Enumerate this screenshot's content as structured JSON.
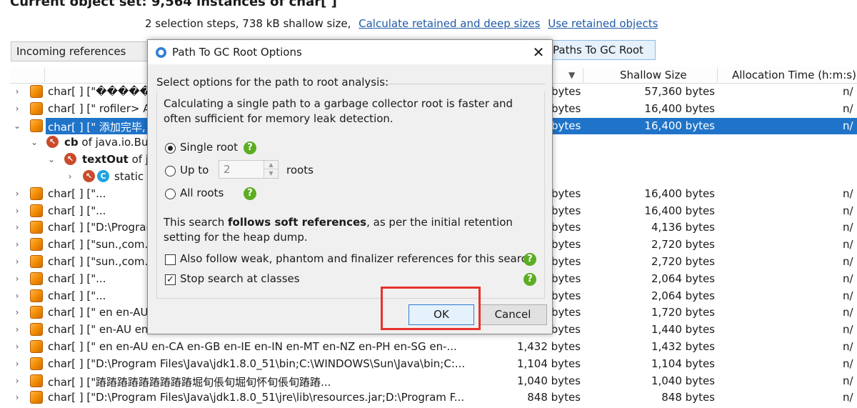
{
  "header": {
    "title": "Current object set:  9,564 instances of char[ ]",
    "summary": "2 selection steps, 738 kB shallow size,",
    "link_calc": "Calculate retained and deep sizes",
    "link_use": "Use retained objects"
  },
  "toolbar": {
    "incoming": "Incoming references",
    "paths": "Paths To GC Root"
  },
  "columns": {
    "sort_arrow": "▼",
    "shallow": "Shallow Size",
    "alloc": "Allocation Time (h:m:s)"
  },
  "rows": [
    {
      "text": "char[ ] [\"������",
      "size": "bytes",
      "shallow": "57,360 bytes",
      "alloc": "n/"
    },
    {
      "text": "char[ ] [\" rofiler> At",
      "size": "bytes",
      "shallow": "16,400 bytes",
      "alloc": "n/"
    },
    {
      "text": "char[ ] [\" 添加完毕,",
      "size": "bytes",
      "shallow": "16,400 bytes",
      "alloc": "n/"
    },
    {
      "bold": "cb",
      "text": " of java.io.Buf"
    },
    {
      "bold": "textOut",
      "text": " of ja"
    },
    {
      "text": "static"
    },
    {
      "text": "char[ ] [\"...",
      "size": "bytes",
      "shallow": "16,400 bytes",
      "alloc": "n/"
    },
    {
      "text": "char[ ] [\"...",
      "size": "bytes",
      "shallow": "16,400 bytes",
      "alloc": "n/"
    },
    {
      "text": "char[ ] [\"D:\\Program",
      "size": "bytes",
      "shallow": "4,136 bytes",
      "alloc": "n/"
    },
    {
      "text": "char[ ] [\"sun.,com.su",
      "size": "bytes",
      "shallow": "2,720 bytes",
      "alloc": "n/"
    },
    {
      "text": "char[ ] [\"sun.,com.su",
      "size": "bytes",
      "shallow": "2,720 bytes",
      "alloc": "n/"
    },
    {
      "text": "char[ ] [\"...",
      "size": "bytes",
      "shallow": "2,064 bytes",
      "alloc": "n/"
    },
    {
      "text": "char[ ] [\"...",
      "size": "bytes",
      "shallow": "2,064 bytes",
      "alloc": "n/"
    },
    {
      "text": "char[ ] [\" en en-AU",
      "size": "bytes",
      "shallow": "1,720 bytes",
      "alloc": "n/"
    },
    {
      "text": "char[ ] [\"  en-AU en-CA en-GB en-IE en-IN en-MT en-NZ en-PH en-SG en-...",
      "size": "1,440 bytes",
      "shallow": "1,440 bytes",
      "alloc": "n/"
    },
    {
      "text": "char[ ] [\"  en en-AU en-CA en-GB en-IE en-IN en-MT en-NZ en-PH en-SG en-...",
      "size": "1,432 bytes",
      "shallow": "1,432 bytes",
      "alloc": "n/"
    },
    {
      "text": "char[ ] [\"D:\\Program Files\\Java\\jdk1.8.0_51\\bin;C:\\WINDOWS\\Sun\\Java\\bin;C:...",
      "size": "1,104 bytes",
      "shallow": "1,104 bytes",
      "alloc": "n/"
    },
    {
      "text": "char[ ] [\"蹖蹖蹖蹖蹖蹖蹖蹖蹖堀旬倀旬堀旬怀旬倀旬蹖蹖...",
      "size": "1,040 bytes",
      "shallow": "1,040 bytes",
      "alloc": "n/"
    },
    {
      "text": "char[ ] [\"D:\\Program Files\\Java\\jdk1.8.0_51\\jre\\lib\\resources.jar;D:\\Program F...",
      "size": "848 bytes",
      "shallow": "848 bytes",
      "alloc": "n/"
    }
  ],
  "dialog": {
    "title": "Path To GC Root Options",
    "close": "✕",
    "group_label": "Select options for the path to root analysis:",
    "intro": "Calculating a single path to a garbage collector root is faster and often sufficient for memory leak detection.",
    "opt_single": "Single root",
    "opt_upto": "Up to",
    "upto_value": "2",
    "upto_suffix": "roots",
    "opt_all": "All roots",
    "soft_pre": "This search ",
    "soft_bold": "follows soft references",
    "soft_post": ", as per the initial retention setting for the heap dump.",
    "chk_weak": "Also follow weak, phantom and finalizer references for this search",
    "chk_stop": "Stop search at classes",
    "ok": "OK",
    "cancel": "Cancel",
    "help_glyph": "?"
  },
  "colors": {
    "selection": "#1f74c9",
    "highlight": "#e6332a",
    "help": "#5cad22"
  }
}
